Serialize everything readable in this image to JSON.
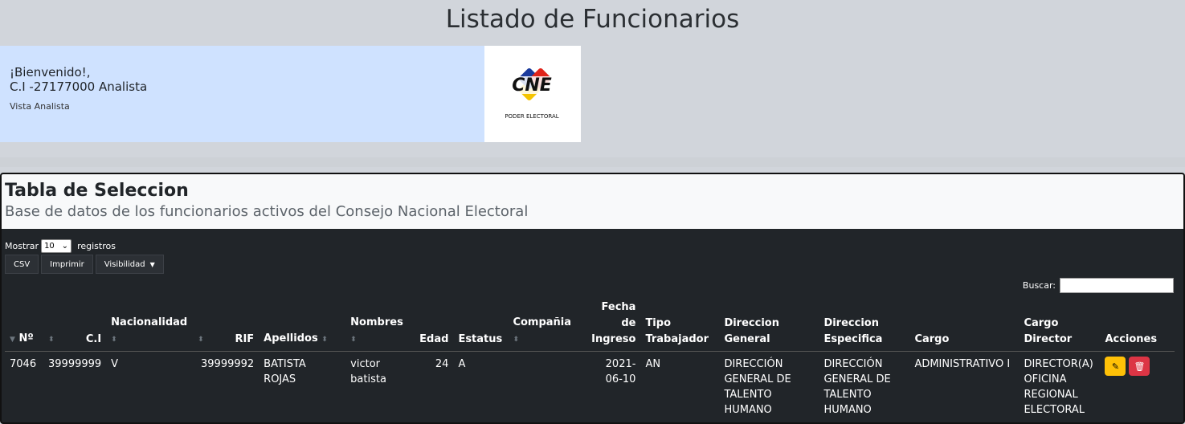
{
  "page": {
    "title": "Listado de Funcionarios"
  },
  "welcome": {
    "line1": "¡Bienvenido!,",
    "line2": "C.I -27177000 Analista",
    "role": "Vista Analista"
  },
  "logo": {
    "text": "CNE",
    "subtitle": "PODER ELECTORAL"
  },
  "card": {
    "title": "Tabla de Seleccion",
    "subtitle": "Base de datos de los funcionarios activos del Consejo Nacional Electoral"
  },
  "length_menu": {
    "prefix": "Mostrar",
    "value": "10",
    "suffix": "registros"
  },
  "toolbar": {
    "csv": "CSV",
    "print": "Imprimir",
    "visibility": "Visibilidad"
  },
  "search": {
    "label": "Buscar:",
    "value": ""
  },
  "table": {
    "headers": [
      "Nº",
      "C.I",
      "Nacionalidad",
      "RIF",
      "Apellidos",
      "Nombres",
      "Edad",
      "Estatus",
      "Compañia",
      "Fecha de Ingreso",
      "Tipo Trabajador",
      "Direccion General",
      "Direccion Especifica",
      "Cargo",
      "Cargo Director",
      "Acciones"
    ],
    "rows": [
      {
        "n": "7046",
        "ci": "39999999",
        "nacionalidad": "V",
        "rif": "39999992",
        "apellidos": "BATISTA ROJAS",
        "nombres": "victor batista",
        "edad": "24",
        "estatus": "A",
        "compania": "",
        "fecha": "2021-06-10",
        "tipo": "AN",
        "dir_general": "DIRECCIÓN GENERAL DE TALENTO HUMANO",
        "dir_especifica": "DIRECCIÓN GENERAL DE TALENTO HUMANO",
        "cargo": "ADMINISTRATIVO I",
        "cargo_director": "DIRECTOR(A) OFICINA REGIONAL ELECTORAL"
      }
    ]
  },
  "colors": {
    "header_bg": "#cfe2ff",
    "card_bg": "#212529",
    "edit": "#ffc107",
    "delete": "#dc3545"
  },
  "icons": [
    "edit-icon",
    "trash-icon",
    "sort-icon",
    "dropdown-caret-icon"
  ]
}
